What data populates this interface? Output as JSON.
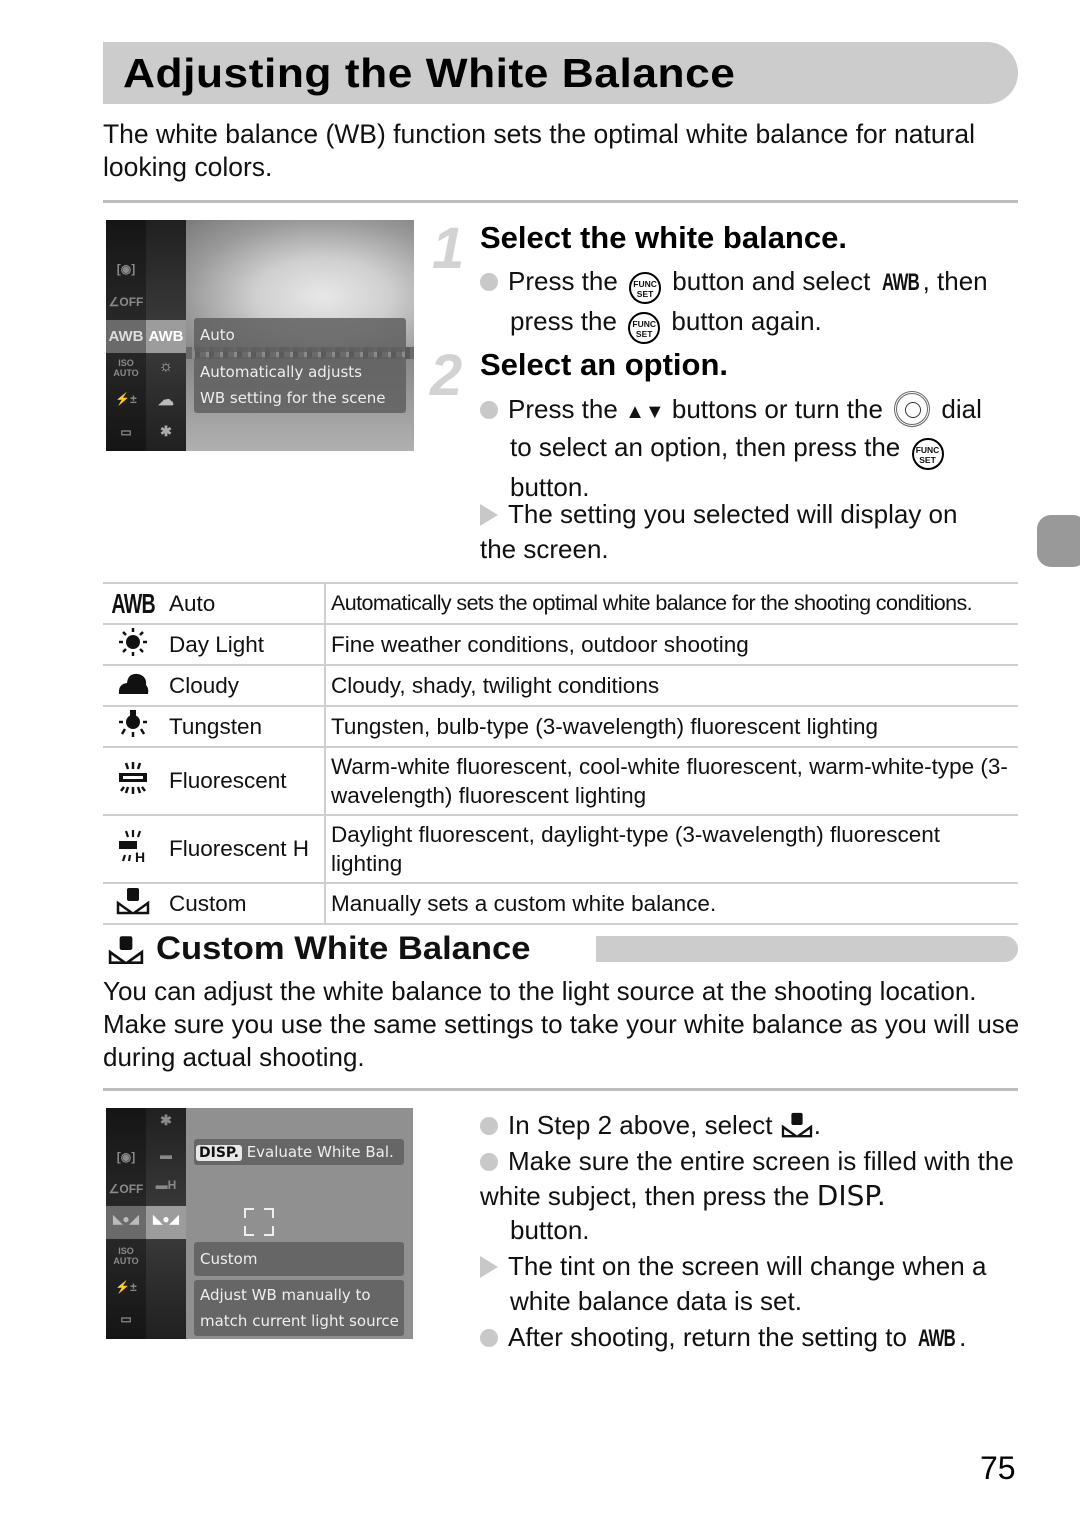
{
  "page": {
    "title": "Adjusting the White Balance",
    "intro": "The white balance (WB) function sets the optimal white balance for natural looking colors.",
    "page_number": "75"
  },
  "screen1": {
    "left_icons": [
      "metering-icon",
      "i-contrast-off-icon",
      "AWB",
      "ISO AUTO",
      "flash-exposure-icon",
      "aspect-icon"
    ],
    "wb_icons": [
      "AWB",
      "daylight-icon",
      "cloudy-icon",
      "tungsten-icon"
    ],
    "selected": "AWB",
    "panel_title": "Auto",
    "panel_desc_1": "Automatically adjusts",
    "panel_desc_2": "WB setting for the scene"
  },
  "steps": [
    {
      "number": "1",
      "title": "Select the white balance.",
      "bullet_parts": [
        "Press the",
        "button and select",
        ", then",
        "press the",
        "button again."
      ],
      "func_label_1": "FUNC",
      "func_label_2": "SET",
      "awb_label": "AWB"
    },
    {
      "number": "2",
      "title": "Select an option.",
      "bullet_parts": [
        "Press the",
        "buttons or turn the",
        "dial",
        "to select an option, then press the",
        "button."
      ],
      "arrows": "▲▼",
      "result": "The setting you selected will display on the screen."
    }
  ],
  "wb_table": [
    {
      "icon": "awb-icon",
      "icon_text": "AWB",
      "name": "Auto",
      "description": "Automatically sets the optimal white balance for the shooting conditions."
    },
    {
      "icon": "daylight-icon",
      "name": "Day Light",
      "description": "Fine weather conditions, outdoor shooting"
    },
    {
      "icon": "cloudy-icon",
      "name": "Cloudy",
      "description": "Cloudy, shady, twilight conditions"
    },
    {
      "icon": "tungsten-icon",
      "name": "Tungsten",
      "description": "Tungsten, bulb-type (3-wavelength) fluorescent lighting"
    },
    {
      "icon": "fluorescent-icon",
      "name": "Fluorescent",
      "description": "Warm-white fluorescent, cool-white fluorescent, warm-white-type (3-wavelength) fluorescent lighting"
    },
    {
      "icon": "fluorescent-h-icon",
      "name": "Fluorescent H",
      "description": "Daylight fluorescent, daylight-type (3-wavelength) fluorescent lighting"
    },
    {
      "icon": "custom-wb-icon",
      "name": "Custom",
      "description": "Manually sets a custom white balance."
    }
  ],
  "custom_section": {
    "title": "Custom White Balance",
    "intro": "You can adjust the white balance to the light source at the shooting location. Make sure you use the same settings to take your white balance as you will use during actual shooting.",
    "screen": {
      "disp_label": "DISP.",
      "evaluate_label": "Evaluate White Bal.",
      "panel_title": "Custom",
      "panel_desc_1": "Adjust WB manually to",
      "panel_desc_2": "match current light source"
    },
    "bullets": [
      {
        "type": "dot",
        "parts": [
          "In Step 2 above, select",
          "."
        ]
      },
      {
        "type": "dot",
        "parts": [
          "Make sure the entire screen is filled with the white subject, then press the",
          "button."
        ],
        "disp": "DISP."
      },
      {
        "type": "result",
        "text": "The tint on the screen will change when a white balance data is set."
      },
      {
        "type": "dot",
        "parts": [
          "After shooting, return the setting to",
          "."
        ],
        "awb": "AWB"
      }
    ]
  },
  "colors": {
    "title_bar": "#cccccc",
    "bullet_gray": "#c8c8c8",
    "rule_gray": "#bdbdbd",
    "side_tab": "#999999"
  }
}
